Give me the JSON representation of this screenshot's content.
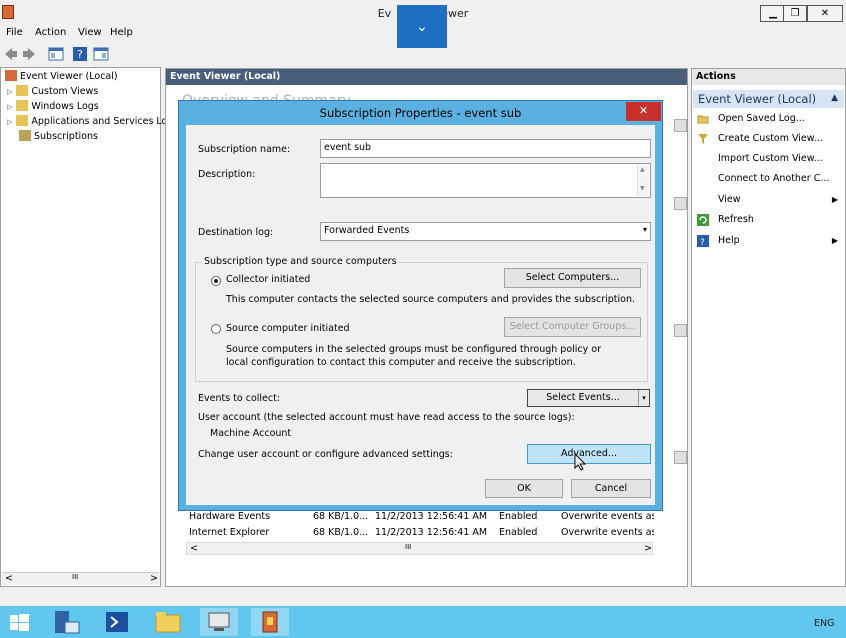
{
  "window": {
    "title_left": "Ev",
    "title_right": "ewer",
    "min": "▁",
    "max": "❐",
    "close": "✕"
  },
  "rdp": {
    "chevron": "⌄"
  },
  "menu": [
    "File",
    "Action",
    "View",
    "Help"
  ],
  "left_tree": {
    "root": "Event Viewer (Local)",
    "items": [
      "Custom Views",
      "Windows Logs",
      "Applications and Services Lo",
      "Subscriptions"
    ]
  },
  "left_scroll": {
    "left": "<",
    "mid": "III",
    "right": ">"
  },
  "center": {
    "header": "Event Viewer (Local)",
    "overview": "Overview and Summary"
  },
  "actions": {
    "header": "Actions",
    "section": "Event Viewer (Local)",
    "items": [
      "Open Saved Log...",
      "Create Custom View...",
      "Import Custom View...",
      "Connect to Another C...",
      "View",
      "Refresh",
      "Help"
    ]
  },
  "dialog": {
    "title": "Subscription Properties - event sub",
    "close": "✕",
    "name_label": "Subscription name:",
    "name_value": "event sub",
    "desc_label": "Description:",
    "dest_label": "Destination log:",
    "dest_value": "Forwarded Events",
    "group_title": "Subscription type and source computers",
    "collector": "Collector initiated",
    "collector_desc": "This computer contacts the selected source computers and provides the subscription.",
    "select_computers": "Select Computers...",
    "source": "Source computer initiated",
    "select_groups": "Select Computer Groups...",
    "source_desc1": "Source computers in the selected groups must be configured through policy or",
    "source_desc2": "local configuration to contact this computer and receive the subscription.",
    "events_label": "Events to collect:",
    "select_events": "Select Events...",
    "user_label": "User account (the selected account must have read access to the source logs):",
    "user_value": "Machine Account",
    "advanced_label": "Change user account or configure advanced settings:",
    "advanced": "Advanced...",
    "ok": "OK",
    "cancel": "Cancel"
  },
  "log_rows": [
    {
      "name": "Hardware Events",
      "size": "68 KB/1.0...",
      "modified": "11/2/2013 12:56:41 AM",
      "enabled": "Enabled",
      "policy": "Overwrite events as n"
    },
    {
      "name": "Internet Explorer",
      "size": "68 KB/1.0...",
      "modified": "11/2/2013 12:56:41 AM",
      "enabled": "Enabled",
      "policy": "Overwrite events as n"
    }
  ],
  "list_scroll": {
    "left": "<",
    "mid": "III",
    "right": ">"
  },
  "taskbar": {
    "lang": "ENG"
  }
}
